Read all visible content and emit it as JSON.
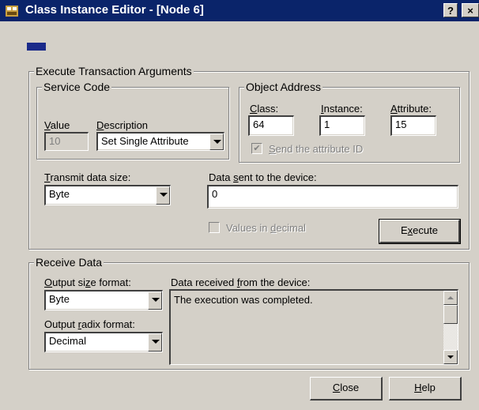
{
  "window": {
    "title": "Class Instance Editor - [Node 6]",
    "help_btn": "?",
    "close_btn": "×"
  },
  "execute": {
    "group_title": "Execute Transaction Arguments",
    "service_code": {
      "title": "Service Code",
      "value_label": "Value",
      "description_label": "Description",
      "value": "10",
      "description": "Set Single Attribute"
    },
    "object_address": {
      "title": "Object Address",
      "class_label": "Class:",
      "instance_label": "Instance:",
      "attribute_label": "Attribute:",
      "class_value": "64",
      "instance_value": "1",
      "attribute_value": "15",
      "send_attr_label": "Send the attribute ID",
      "send_attr_check": "✔"
    },
    "transmit_label": "Transmit data size:",
    "transmit_value": "Byte",
    "data_sent_label": "Data sent to the device:",
    "data_sent_value": "0",
    "values_decimal_label": "Values in decimal",
    "execute_button": "Execute"
  },
  "receive": {
    "group_title": "Receive Data",
    "output_size_label": "Output size format:",
    "output_size_value": "Byte",
    "output_radix_label": "Output radix format:",
    "output_radix_value": "Decimal",
    "data_received_label": "Data received from the device:",
    "data_received_text": "The execution was completed."
  },
  "buttons": {
    "close": "Close",
    "help": "Help"
  }
}
